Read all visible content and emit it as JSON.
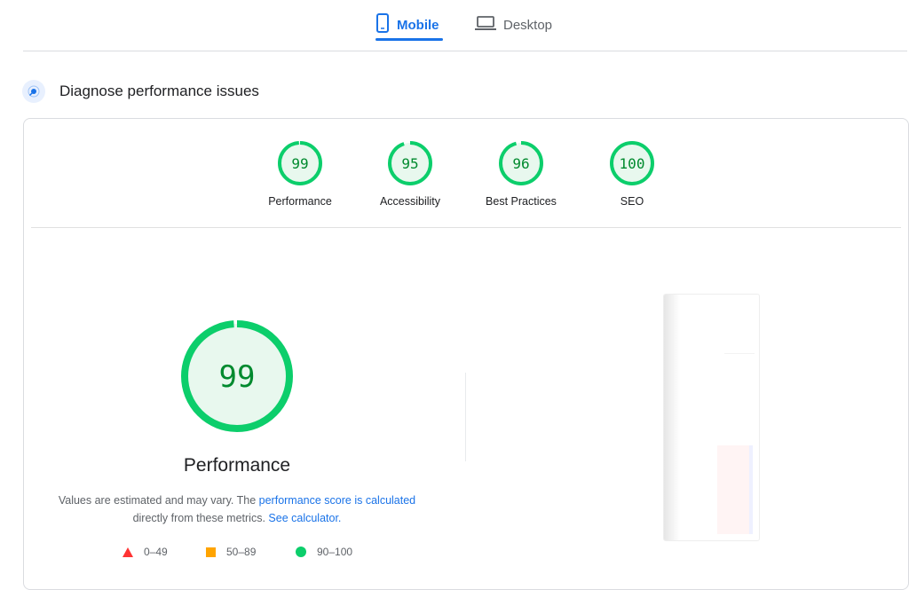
{
  "tabs": {
    "mobile": {
      "label": "Mobile",
      "icon": "smartphone-icon",
      "active": true
    },
    "desktop": {
      "label": "Desktop",
      "icon": "laptop-icon",
      "active": false
    }
  },
  "section": {
    "title": "Diagnose performance issues",
    "icon": "diagnose-icon"
  },
  "categories": [
    {
      "label": "Performance",
      "score": "99",
      "value": 0.99
    },
    {
      "label": "Accessibility",
      "score": "95",
      "value": 0.95
    },
    {
      "label": "Best Practices",
      "score": "96",
      "value": 0.96
    },
    {
      "label": "SEO",
      "score": "100",
      "value": 1.0
    }
  ],
  "main": {
    "score": "99",
    "value": 0.99,
    "title": "Performance",
    "desc_prefix": "Values are estimated and may vary. The ",
    "desc_link1": "performance score is calculated",
    "desc_mid": "directly from these metrics. ",
    "desc_link2": "See calculator."
  },
  "legend": [
    {
      "range": "0–49",
      "icon": "red-triangle-icon"
    },
    {
      "range": "50–89",
      "icon": "orange-square-icon"
    },
    {
      "range": "90–100",
      "icon": "green-circle-icon"
    }
  ],
  "colors": {
    "accent": "#1a73e8",
    "pass_stroke": "#0cce6b",
    "pass_fill": "#e8f8ee",
    "pass_text": "#008a2e",
    "fail": "#ff3333",
    "average": "#ffa400"
  }
}
